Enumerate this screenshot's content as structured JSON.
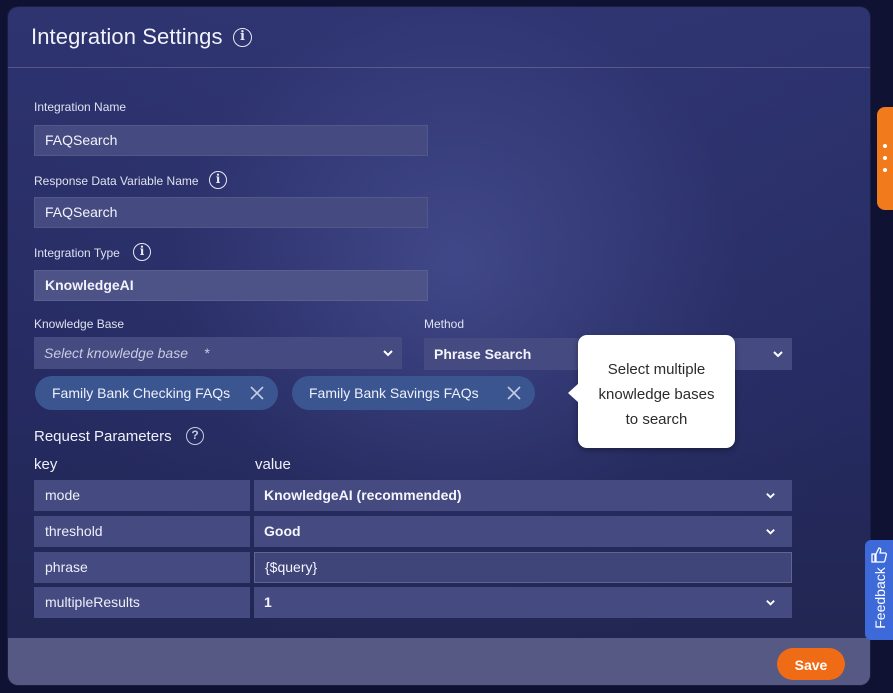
{
  "header": {
    "title": "Integration Settings"
  },
  "form": {
    "integration_name_label": "Integration Name",
    "integration_name_value": "FAQSearch",
    "response_var_label": "Response Data Variable Name",
    "response_var_value": "FAQSearch",
    "integration_type_label": "Integration Type",
    "integration_type_value": "KnowledgeAI",
    "knowledge_base_label": "Knowledge Base",
    "knowledge_base_placeholder": "Select knowledge base",
    "knowledge_base_required": "*",
    "method_label": "Method",
    "method_value": "Phrase Search",
    "selected_knowledge_bases": [
      "Family Bank Checking FAQs",
      "Family Bank Savings FAQs"
    ]
  },
  "tooltip": {
    "lines": [
      "Select multiple",
      "knowledge bases",
      "to search"
    ]
  },
  "request_parameters": {
    "title": "Request Parameters",
    "key_header": "key",
    "value_header": "value",
    "rows": [
      {
        "key": "mode",
        "value": "KnowledgeAI (recommended)"
      },
      {
        "key": "threshold",
        "value": "Good"
      },
      {
        "key": "phrase",
        "value": "{$query}"
      },
      {
        "key": "multipleResults",
        "value": "1"
      }
    ]
  },
  "footer": {
    "save_label": "Save"
  },
  "side": {
    "feedback_label": "Feedback"
  },
  "colors": {
    "accent": "#f06b16",
    "chip": "#3b5590",
    "feedback": "#3d6ad8"
  }
}
